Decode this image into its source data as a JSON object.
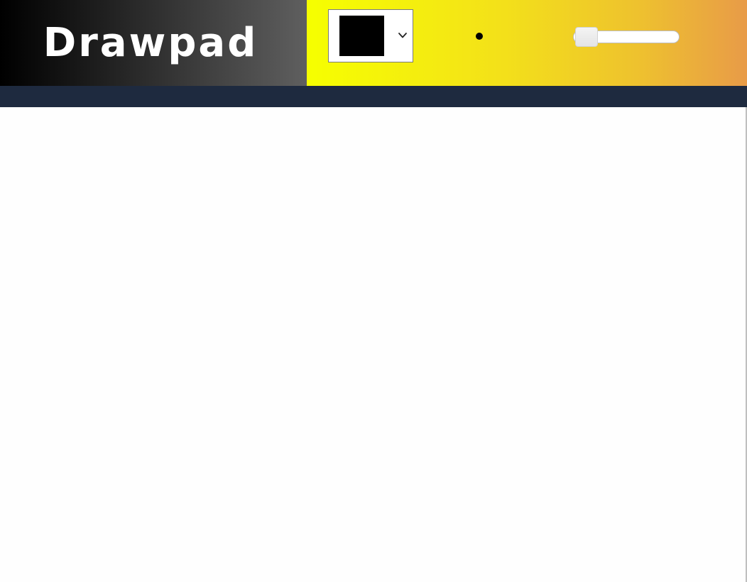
{
  "app": {
    "title": "Drawpad"
  },
  "toolbar": {
    "color_picker": {
      "selected_color": "#000000",
      "icon": "chevron-down-icon"
    },
    "brush_preview": {
      "color": "#000000",
      "icon": "dot-icon"
    },
    "brush_size_slider": {
      "level": 0.1
    }
  },
  "colors": {
    "brand_gradient": [
      "#000000",
      "#5f5f5f"
    ],
    "toolbar_gradient": [
      "#f6ff00",
      "#e89b48"
    ],
    "nav_bar": "#1e2a3f",
    "canvas": "#fefefe"
  }
}
